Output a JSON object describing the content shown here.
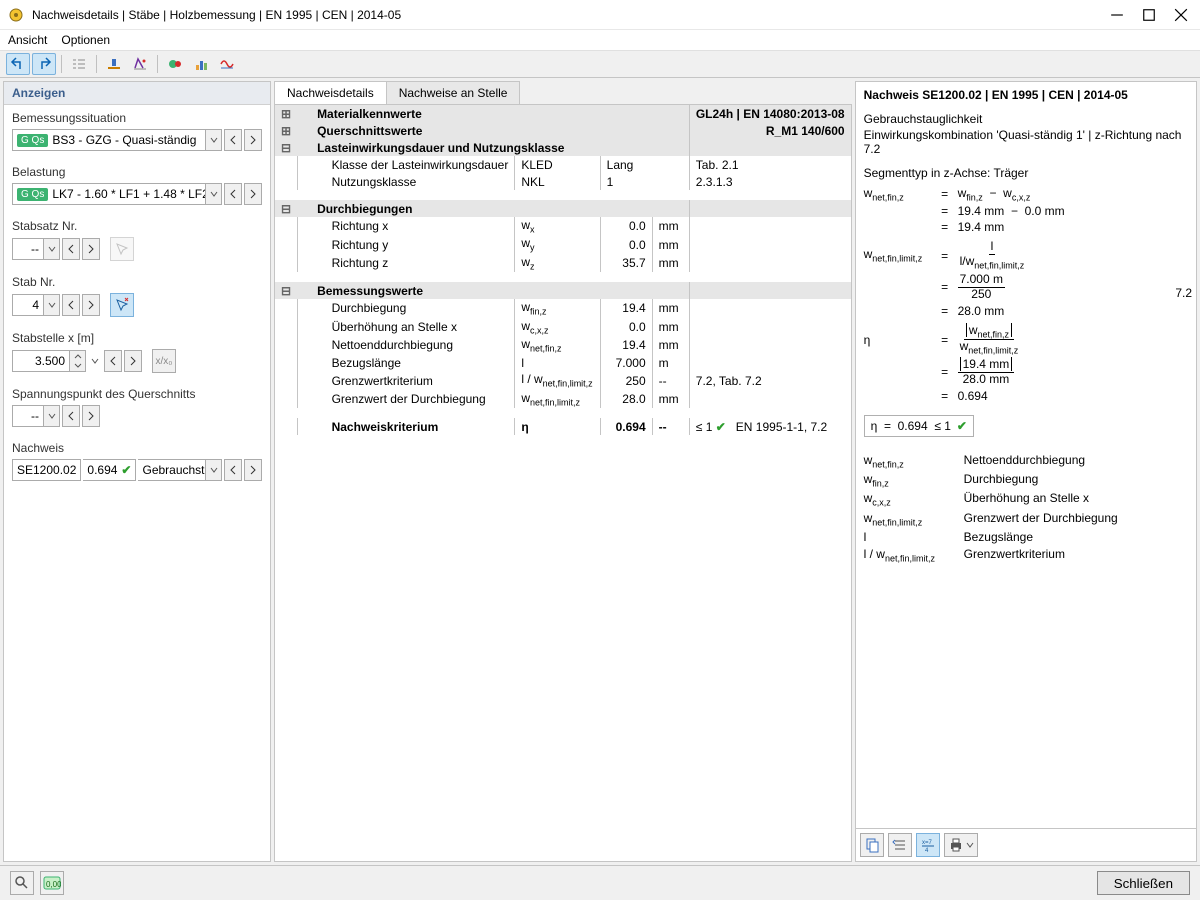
{
  "window": {
    "title": "Nachweisdetails | Stäbe | Holzbemessung | EN 1995 | CEN | 2014-05"
  },
  "menu": {
    "ansicht": "Ansicht",
    "optionen": "Optionen"
  },
  "left": {
    "header": "Anzeigen",
    "situation_label": "Bemessungssituation",
    "situation_badge": "G Qs",
    "situation_value": "BS3 - GZG - Quasi-ständig",
    "belastung_label": "Belastung",
    "belastung_badge": "G Qs",
    "belastung_value": "LK7 - 1.60 * LF1 + 1.48 * LF2 ...",
    "stabsatz_label": "Stabsatz Nr.",
    "stabsatz_value": "--",
    "stabnr_label": "Stab Nr.",
    "stabnr_value": "4",
    "stelle_label": "Stabstelle x [m]",
    "stelle_value": "3.500",
    "spannung_label": "Spannungspunkt des Querschnitts",
    "spannung_value": "--",
    "nachweis_label": "Nachweis",
    "nachweis_code": "SE1200.02",
    "nachweis_val": "0.694",
    "nachweis_desc": "Gebrauchst..."
  },
  "tabs": {
    "t1": "Nachweisdetails",
    "t2": "Nachweise an Stelle"
  },
  "detail": {
    "material_h": "Materialkennwerte",
    "material_r": "GL24h | EN 14080:2013-08",
    "quers_h": "Querschnittswerte",
    "quers_r": "R_M1 140/600",
    "dauer_h": "Lasteinwirkungsdauer und Nutzungsklasse",
    "rows1": [
      [
        "Klasse der Lasteinwirkungsdauer",
        "KLED",
        "",
        "Lang",
        "",
        "Tab. 2.1"
      ],
      [
        "Nutzungsklasse",
        "NKL",
        "",
        "1",
        "",
        "2.3.1.3"
      ]
    ],
    "durch_h": "Durchbiegungen",
    "rows2": [
      [
        "Richtung x",
        [
          "w",
          "x"
        ],
        "0.0",
        "mm",
        "",
        ""
      ],
      [
        "Richtung y",
        [
          "w",
          "y"
        ],
        "0.0",
        "mm",
        "",
        ""
      ],
      [
        "Richtung z",
        [
          "w",
          "z"
        ],
        "35.7",
        "mm",
        "",
        ""
      ]
    ],
    "bem_h": "Bemessungswerte",
    "rows3": [
      [
        "Durchbiegung",
        [
          "w",
          "fin,z"
        ],
        "19.4",
        "mm",
        "",
        ""
      ],
      [
        "Überhöhung an Stelle x",
        [
          "w",
          "c,x,z"
        ],
        "0.0",
        "mm",
        "",
        ""
      ],
      [
        "Nettoenddurchbiegung",
        [
          "w",
          "net,fin,z"
        ],
        "19.4",
        "mm",
        "",
        ""
      ],
      [
        "Bezugslänge",
        "l",
        "7.000",
        "m",
        "",
        ""
      ],
      [
        "Grenzwertkriterium",
        [
          "l / w",
          "net,fin,limit,z"
        ],
        "250",
        "--",
        "",
        "7.2, Tab. 7.2"
      ],
      [
        "Grenzwert der Durchbiegung",
        [
          "w",
          "net,fin,limit,z"
        ],
        "28.0",
        "mm",
        "",
        ""
      ]
    ],
    "crit": [
      "Nachweiskriterium",
      "η",
      "0.694",
      "--",
      "≤ 1",
      "EN 1995-1-1, 7.2"
    ]
  },
  "right": {
    "title": "Nachweis SE1200.02 | EN 1995 | CEN | 2014-05",
    "l1": "Gebrauchstauglichkeit",
    "l2": "Einwirkungskombination 'Quasi-ständig 1' | z-Richtung nach 7.2",
    "segtype": "Segmenttyp in z-Achse: Träger",
    "side_ref": "7.2",
    "eq1": {
      "val": "19.4 mm",
      "minus": "−",
      "sub": "0.0 mm",
      "res": "19.4 mm"
    },
    "eq2": {
      "top": "l",
      "bot": [
        "l/w",
        "net,fin,limit,z"
      ],
      "f2t": "7.000 m",
      "f2b": "250",
      "res": "28.0 mm"
    },
    "eq3": {
      "t": [
        "w",
        "net,fin,z"
      ],
      "b": [
        "w",
        "net,fin,limit,z"
      ],
      "t2": "19.4 mm",
      "b2": "28.0 mm",
      "res": "0.694"
    },
    "result": [
      "η",
      "=",
      "0.694",
      "≤ 1"
    ],
    "defs": [
      [
        [
          "w",
          "net,fin,z"
        ],
        "Nettoenddurchbiegung"
      ],
      [
        [
          "w",
          "fin,z"
        ],
        "Durchbiegung"
      ],
      [
        [
          "w",
          "c,x,z"
        ],
        "Überhöhung an Stelle x"
      ],
      [
        [
          "w",
          "net,fin,limit,z"
        ],
        "Grenzwert der Durchbiegung"
      ],
      [
        "l",
        "Bezugslänge"
      ],
      [
        [
          "l / w",
          "net,fin,limit,z"
        ],
        "Grenzwertkriterium"
      ]
    ]
  },
  "footer": {
    "close": "Schließen"
  },
  "icons": {
    "x0": "x/x₀"
  }
}
